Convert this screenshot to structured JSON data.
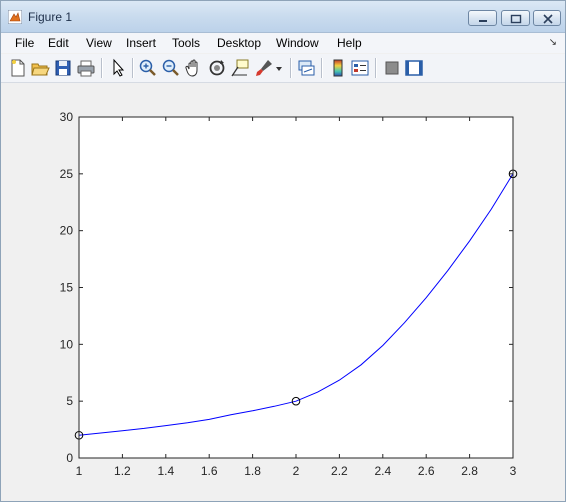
{
  "window": {
    "title": "Figure 1"
  },
  "menu": {
    "items": [
      "File",
      "Edit",
      "View",
      "Insert",
      "Tools",
      "Desktop",
      "Window",
      "Help"
    ]
  },
  "toolbar": {
    "icons": [
      "new-figure-icon",
      "open-file-icon",
      "save-icon",
      "print-icon",
      "edit-plot-icon",
      "zoom-in-icon",
      "zoom-out-icon",
      "pan-icon",
      "rotate-3d-icon",
      "data-cursor-icon",
      "brush-icon",
      "brush-dropdown-icon",
      "link-plot-icon",
      "insert-colorbar-icon",
      "insert-legend-icon",
      "hide-plot-tools-icon",
      "show-plot-tools-icon"
    ]
  },
  "chart_data": {
    "type": "line",
    "title": "",
    "xlabel": "",
    "ylabel": "",
    "xlim": [
      1,
      3
    ],
    "ylim": [
      0,
      30
    ],
    "xticks": [
      1,
      1.2,
      1.4,
      1.6,
      1.8,
      2,
      2.2,
      2.4,
      2.6,
      2.8,
      3
    ],
    "xtick_labels": [
      "1",
      "1.2",
      "1.4",
      "1.6",
      "1.8",
      "2",
      "2.2",
      "2.4",
      "2.6",
      "2.8",
      "3"
    ],
    "yticks": [
      0,
      5,
      10,
      15,
      20,
      25,
      30
    ],
    "ytick_labels": [
      "0",
      "5",
      "10",
      "15",
      "20",
      "25",
      "30"
    ],
    "grid": false,
    "series": [
      {
        "line_color": "#0000ff",
        "x": [
          1.0,
          1.1,
          1.2,
          1.3,
          1.4,
          1.5,
          1.6,
          1.7,
          1.8,
          1.9,
          2.0,
          2.1,
          2.2,
          2.3,
          2.4,
          2.5,
          2.6,
          2.7,
          2.8,
          2.9,
          3.0
        ],
        "y": [
          2.0,
          2.2,
          2.4,
          2.6,
          2.85,
          3.1,
          3.4,
          3.8,
          4.15,
          4.55,
          5.0,
          5.8,
          6.85,
          8.2,
          9.9,
          11.9,
          14.1,
          16.5,
          19.1,
          21.9,
          25.0
        ]
      }
    ],
    "markers": {
      "shape": "circle",
      "color": "#000000",
      "x": [
        1,
        2,
        3
      ],
      "y": [
        2,
        5,
        25
      ]
    }
  }
}
